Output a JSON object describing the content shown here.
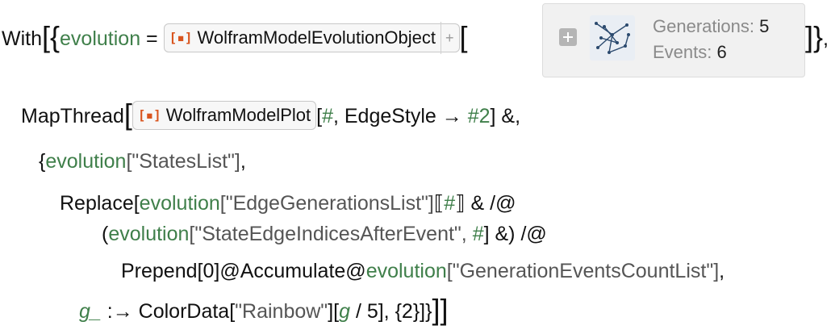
{
  "line1": {
    "with": "With",
    "var": "evolution",
    "eq": " = ",
    "chip_label": "WolframModelEvolutionObject",
    "chip_icon": "[▪]",
    "chip_plus": "+",
    "open_bracket": "[",
    "close_bracket": "]}",
    "comma": ","
  },
  "panel": {
    "gen_label": "Generations: ",
    "gen_value": "5",
    "ev_label": "Events: ",
    "ev_value": "6"
  },
  "line2": {
    "mapthread": "MapThread",
    "chip_label": "WolframModelPlot",
    "chip_icon": "[▪]",
    "args_open": "[",
    "slot1": "#",
    "edgestyle": ", EdgeStyle → ",
    "slot2": "#2",
    "tail": "] &,"
  },
  "line3": {
    "open": "{",
    "var": "evolution",
    "str": "[\"StatesList\"]",
    "tail": ","
  },
  "line4": {
    "replace": "Replace[",
    "var": "evolution",
    "str": "[\"EdgeGenerationsList\"]",
    "part_open": "⟦",
    "slot": "#",
    "part_close": "⟧",
    "tail": " & /@"
  },
  "line5": {
    "open": "(",
    "var": "evolution",
    "str": "[\"StateEdgeIndicesAfterEvent\", ",
    "slot": "#",
    "tail": "] &) /@"
  },
  "line6": {
    "prepend": "Prepend[0]@Accumulate@",
    "var": "evolution",
    "str": "[\"GenerationEventsCountList\"]",
    "tail": ","
  },
  "line7": {
    "pat": "g_",
    "rule": " :→ ColorData[",
    "str": "\"Rainbow\"",
    "mid": "][",
    "g": "g",
    "tail": " / 5], {2}]}",
    "close": "]]"
  },
  "colors": {
    "variable": "#3f7f4a",
    "string": "#555555",
    "icon": "#d9541e",
    "graph": "#2b4a6e"
  }
}
